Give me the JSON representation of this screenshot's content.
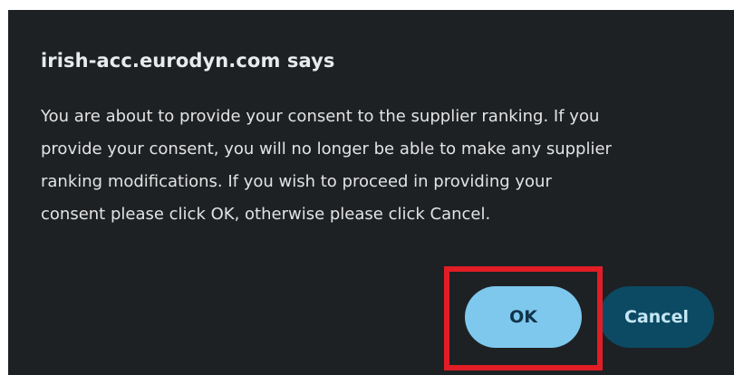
{
  "dialog": {
    "title": "irish-acc.eurodyn.com says",
    "message": "You are about to provide your consent to the supplier ranking. If you\nprovide your consent, you will no longer be able to make any supplier\nranking modifications. If you wish to proceed in providing your\nconsent please click OK, otherwise please click Cancel.",
    "ok_label": "OK",
    "cancel_label": "Cancel"
  },
  "colors": {
    "dialog_background": "#1e2124",
    "ok_button": "#7ec8ee",
    "cancel_button": "#0c4a63",
    "highlight": "#e21d25"
  }
}
